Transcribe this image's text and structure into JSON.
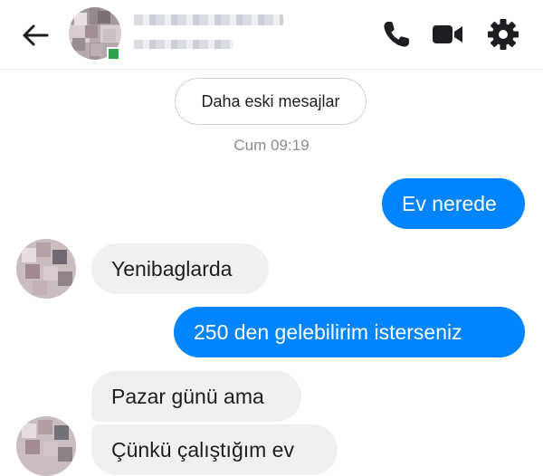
{
  "header": {
    "back_icon": "arrow-left-icon",
    "icons": [
      "phone-icon",
      "video-camera-icon",
      "gear-icon"
    ],
    "accent_color": "#0084ff"
  },
  "conversation": {
    "older_messages_label": "Daha eski mesajlar",
    "timestamp": "Cum 09:19",
    "messages": [
      {
        "direction": "outgoing",
        "text": "Ev nerede"
      },
      {
        "direction": "incoming",
        "text": "Yenibaglarda"
      },
      {
        "direction": "outgoing",
        "text": "250 den gelebilirim isterseniz"
      },
      {
        "direction": "incoming",
        "text": "Pazar günü ama"
      },
      {
        "direction": "incoming",
        "text": "Çünkü çalıştığım ev"
      }
    ],
    "incoming_color": "#f0f0f0",
    "outgoing_color": "#0084ff"
  }
}
